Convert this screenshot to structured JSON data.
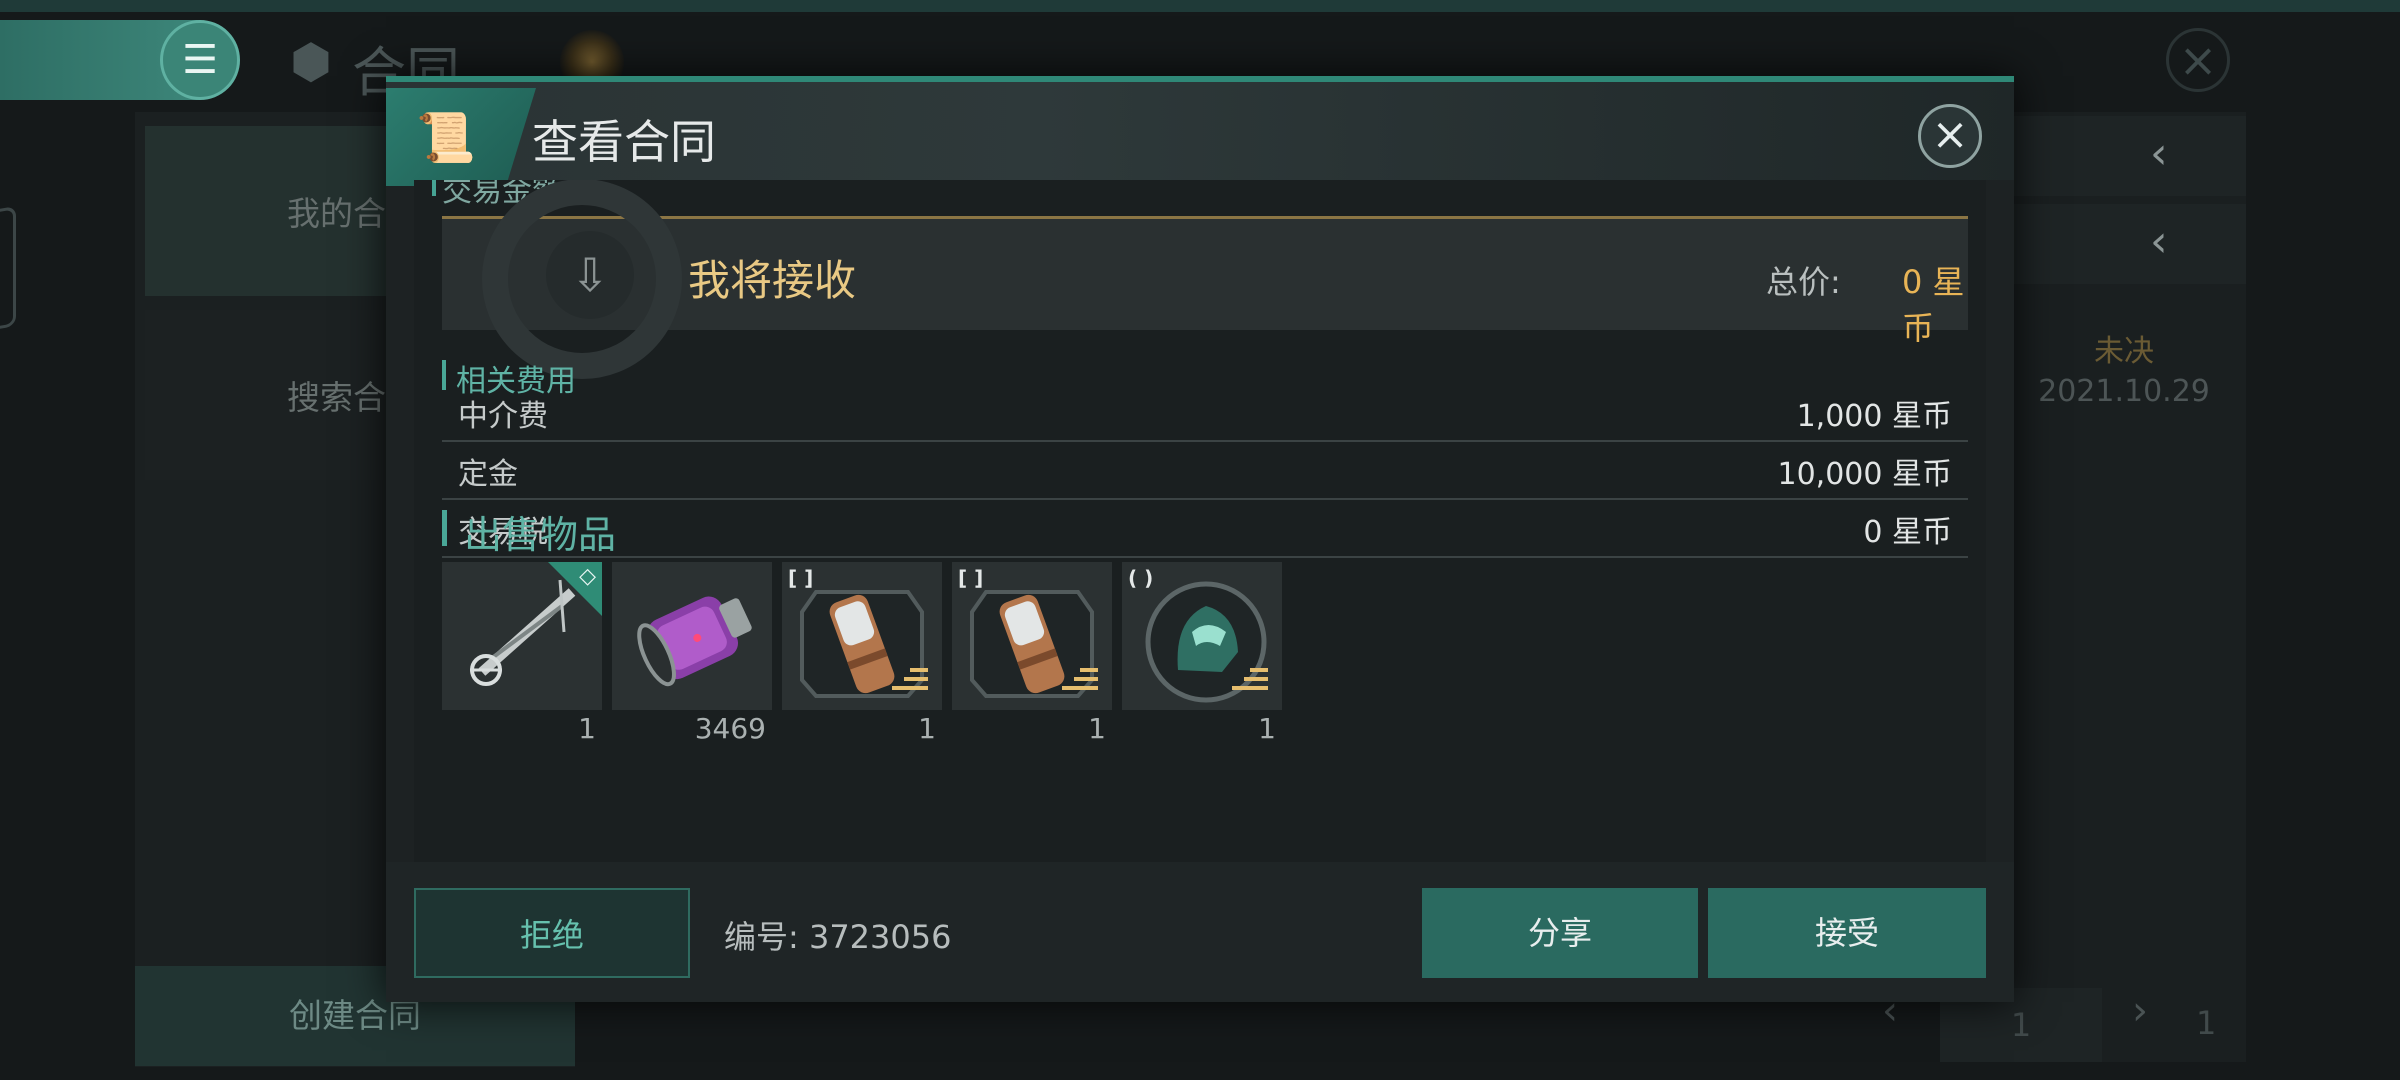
{
  "background": {
    "title": "合同",
    "left_menu": {
      "items": [
        "我的合",
        "搜索合"
      ],
      "create_label": "创建合同"
    },
    "right_panel": {
      "status": "未决",
      "date": "2021.10.29"
    },
    "pager": {
      "current_page": "1",
      "total_pages": "1"
    }
  },
  "modal": {
    "title": "查看合同",
    "cut_heading": "交易金额",
    "receive_card": {
      "label": "我将接收",
      "total_label": "总价:",
      "total_value": "0 星币"
    },
    "fees": {
      "section_title": "相关费用",
      "rows": [
        {
          "name": "中介费",
          "value": "1,000 星币"
        },
        {
          "name": "定金",
          "value": "10,000 星币"
        },
        {
          "name": "交易税",
          "value": "0 星币"
        }
      ]
    },
    "items": {
      "section_title": "出售物品",
      "list": [
        {
          "kind": "ship-icon",
          "qty": "1",
          "tag": "",
          "corner": "◇"
        },
        {
          "kind": "purple-canister-icon",
          "qty": "3469",
          "tag": "",
          "corner": ""
        },
        {
          "kind": "copper-cylinder-icon",
          "qty": "1",
          "tag": "[ ]",
          "corner": ""
        },
        {
          "kind": "copper-cylinder-icon",
          "qty": "1",
          "tag": "[ ]",
          "corner": ""
        },
        {
          "kind": "green-helmet-icon",
          "qty": "1",
          "tag": "( )",
          "corner": ""
        }
      ]
    },
    "footer": {
      "reject_label": "拒绝",
      "contract_id": "编号: 3723056",
      "share_label": "分享",
      "accept_label": "接受"
    }
  },
  "colors": {
    "accent_teal": "#2a6a60",
    "gold_text": "#e9c984",
    "price_orange": "#e8b456"
  }
}
